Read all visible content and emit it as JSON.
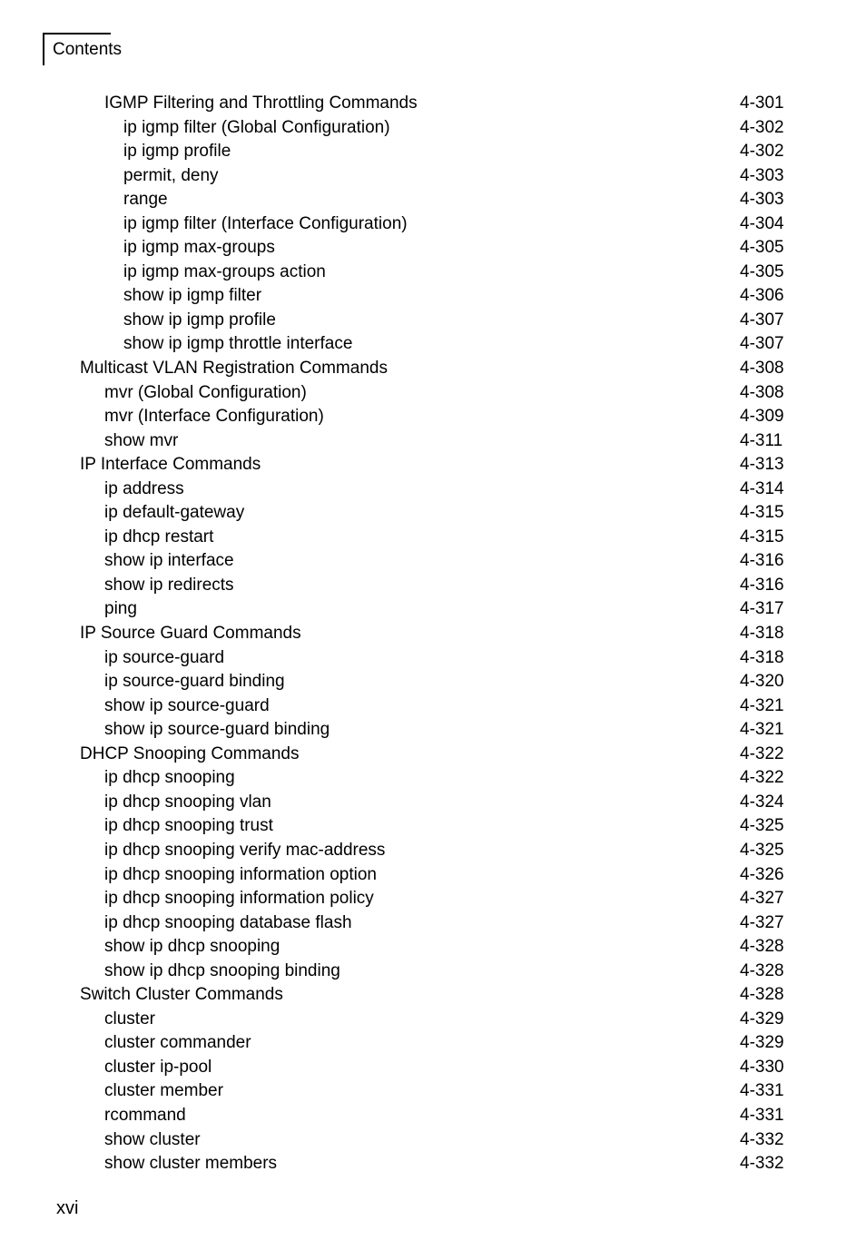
{
  "header": {
    "title": "Contents"
  },
  "footer": {
    "page_number": "xvi"
  },
  "toc": {
    "entries": [
      {
        "label": "IGMP Filtering and Throttling Commands",
        "page": "4-301",
        "level": 2
      },
      {
        "label": "ip igmp filter (Global Configuration)",
        "page": "4-302",
        "level": 3
      },
      {
        "label": "ip igmp profile",
        "page": "4-302",
        "level": 3
      },
      {
        "label": "permit, deny",
        "page": "4-303",
        "level": 3
      },
      {
        "label": "range",
        "page": "4-303",
        "level": 3
      },
      {
        "label": "ip igmp filter (Interface Configuration)",
        "page": "4-304",
        "level": 3
      },
      {
        "label": "ip igmp max-groups",
        "page": "4-305",
        "level": 3
      },
      {
        "label": "ip igmp max-groups action",
        "page": "4-305",
        "level": 3
      },
      {
        "label": "show ip igmp filter",
        "page": "4-306",
        "level": 3
      },
      {
        "label": "show ip igmp profile",
        "page": "4-307",
        "level": 3
      },
      {
        "label": "show ip igmp throttle interface",
        "page": "4-307",
        "level": 3
      },
      {
        "label": "Multicast VLAN Registration Commands",
        "page": "4-308",
        "level": 1
      },
      {
        "label": "mvr (Global Configuration)",
        "page": "4-308",
        "level": 2
      },
      {
        "label": "mvr (Interface Configuration)",
        "page": "4-309",
        "level": 2
      },
      {
        "label": "show mvr",
        "page": "4-311",
        "level": 2
      },
      {
        "label": "IP Interface Commands",
        "page": "4-313",
        "level": 1
      },
      {
        "label": "ip address",
        "page": "4-314",
        "level": 2
      },
      {
        "label": "ip default-gateway",
        "page": "4-315",
        "level": 2
      },
      {
        "label": "ip dhcp restart",
        "page": "4-315",
        "level": 2
      },
      {
        "label": "show ip interface",
        "page": "4-316",
        "level": 2
      },
      {
        "label": "show ip redirects",
        "page": "4-316",
        "level": 2
      },
      {
        "label": "ping",
        "page": "4-317",
        "level": 2
      },
      {
        "label": "IP Source Guard Commands",
        "page": "4-318",
        "level": 1
      },
      {
        "label": "ip source-guard",
        "page": "4-318",
        "level": 2
      },
      {
        "label": "ip source-guard binding",
        "page": "4-320",
        "level": 2
      },
      {
        "label": "show ip source-guard",
        "page": "4-321",
        "level": 2
      },
      {
        "label": "show ip source-guard binding",
        "page": "4-321",
        "level": 2
      },
      {
        "label": "DHCP Snooping Commands",
        "page": "4-322",
        "level": 1
      },
      {
        "label": "ip dhcp snooping",
        "page": "4-322",
        "level": 2
      },
      {
        "label": "ip dhcp snooping vlan",
        "page": "4-324",
        "level": 2
      },
      {
        "label": "ip dhcp snooping trust",
        "page": "4-325",
        "level": 2
      },
      {
        "label": "ip dhcp snooping verify mac-address",
        "page": "4-325",
        "level": 2
      },
      {
        "label": "ip dhcp snooping information option",
        "page": "4-326",
        "level": 2
      },
      {
        "label": "ip dhcp snooping information policy",
        "page": "4-327",
        "level": 2
      },
      {
        "label": "ip dhcp snooping database flash",
        "page": "4-327",
        "level": 2
      },
      {
        "label": "show ip dhcp snooping",
        "page": "4-328",
        "level": 2
      },
      {
        "label": "show ip dhcp snooping binding",
        "page": "4-328",
        "level": 2
      },
      {
        "label": "Switch Cluster Commands",
        "page": "4-328",
        "level": 1
      },
      {
        "label": "cluster",
        "page": "4-329",
        "level": 2
      },
      {
        "label": "cluster commander",
        "page": "4-329",
        "level": 2
      },
      {
        "label": "cluster ip-pool",
        "page": "4-330",
        "level": 2
      },
      {
        "label": "cluster member",
        "page": "4-331",
        "level": 2
      },
      {
        "label": "rcommand",
        "page": "4-331",
        "level": 2
      },
      {
        "label": "show cluster",
        "page": "4-332",
        "level": 2
      },
      {
        "label": "show cluster members",
        "page": "4-332",
        "level": 2
      }
    ]
  }
}
